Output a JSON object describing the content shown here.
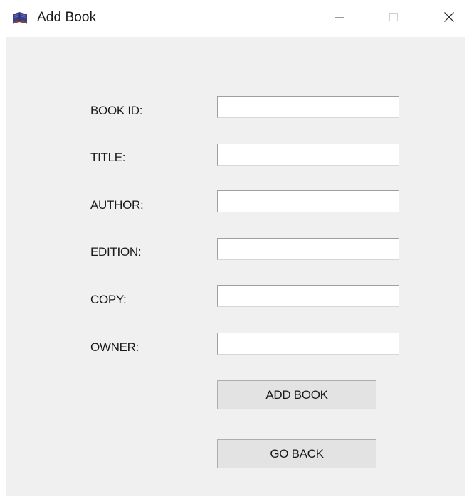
{
  "window": {
    "title": "Add Book",
    "app_icon": "book-icon",
    "controls": {
      "minimize_icon": "minimize-icon",
      "maximize_icon": "maximize-icon",
      "close_icon": "close-icon"
    }
  },
  "form": {
    "fields": [
      {
        "label": "BOOK ID:",
        "value": ""
      },
      {
        "label": "TITLE:",
        "value": ""
      },
      {
        "label": "AUTHOR:",
        "value": ""
      },
      {
        "label": "EDITION:",
        "value": ""
      },
      {
        "label": "COPY:",
        "value": ""
      },
      {
        "label": "OWNER:",
        "value": ""
      }
    ],
    "add_button_label": "ADD BOOK",
    "back_button_label": "GO BACK"
  },
  "colors": {
    "client_background": "#f0f0f0",
    "titlebar_background": "#ffffff",
    "button_background": "#e3e3e3",
    "button_border": "#adadad"
  }
}
